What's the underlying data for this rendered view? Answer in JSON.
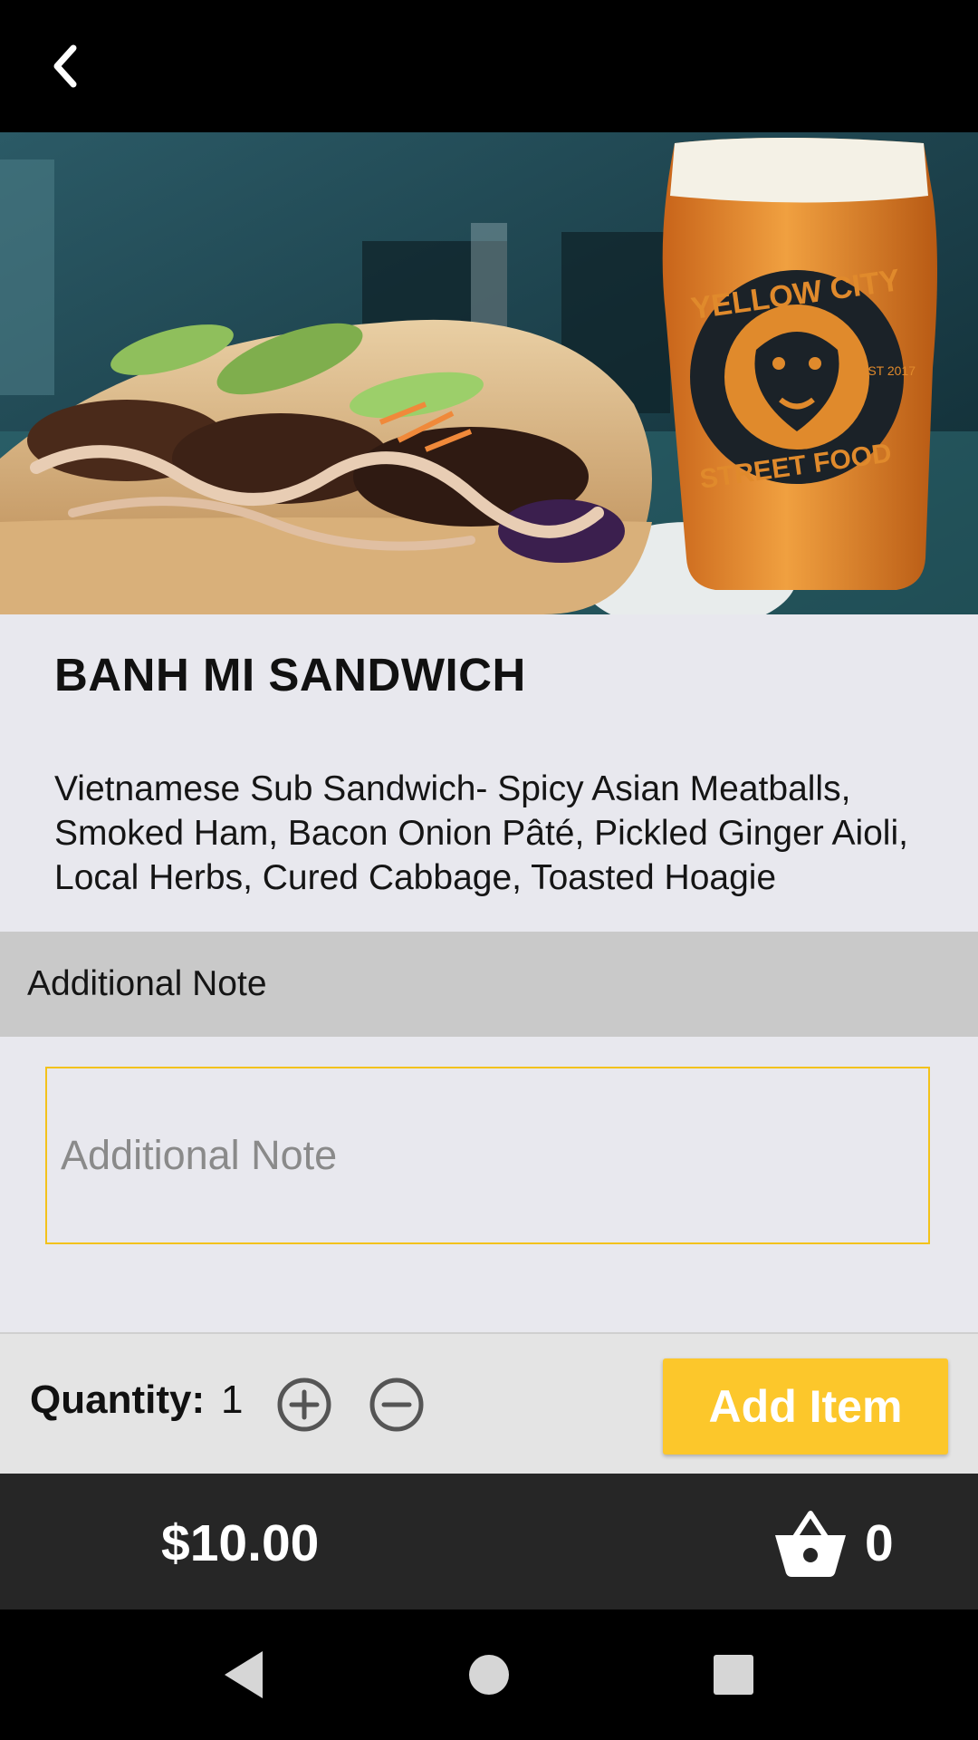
{
  "item": {
    "title": "BANH MI SANDWICH",
    "description": "Vietnamese Sub Sandwich- Spicy Asian Meatballs, Smoked Ham, Bacon Onion Pâté, Pickled Ginger Aioli, Local Herbs, Cured Cabbage, Toasted Hoagie",
    "image_alt": "Banh mi sandwich with a glass of beer",
    "glass_text": {
      "top": "YELLOW CITY",
      "bottom": "STREET FOOD",
      "badge": "EST 2017"
    }
  },
  "note_section": {
    "header": "Additional Note",
    "placeholder": "Additional Note",
    "value": ""
  },
  "quantity": {
    "label": "Quantity:",
    "value": "1",
    "increment_icon": "plus-circle-icon",
    "decrement_icon": "minus-circle-icon"
  },
  "add_button": {
    "label": "Add Item"
  },
  "footer": {
    "price": "$10.00",
    "cart_icon": "basket-icon",
    "cart_count": "0"
  },
  "colors": {
    "accent": "#fcc72b",
    "input_border": "#f3c21b",
    "topbar": "#000000",
    "footer": "#262626",
    "section_header": "#c9c9c9",
    "page_background": "#e8e8ee"
  }
}
